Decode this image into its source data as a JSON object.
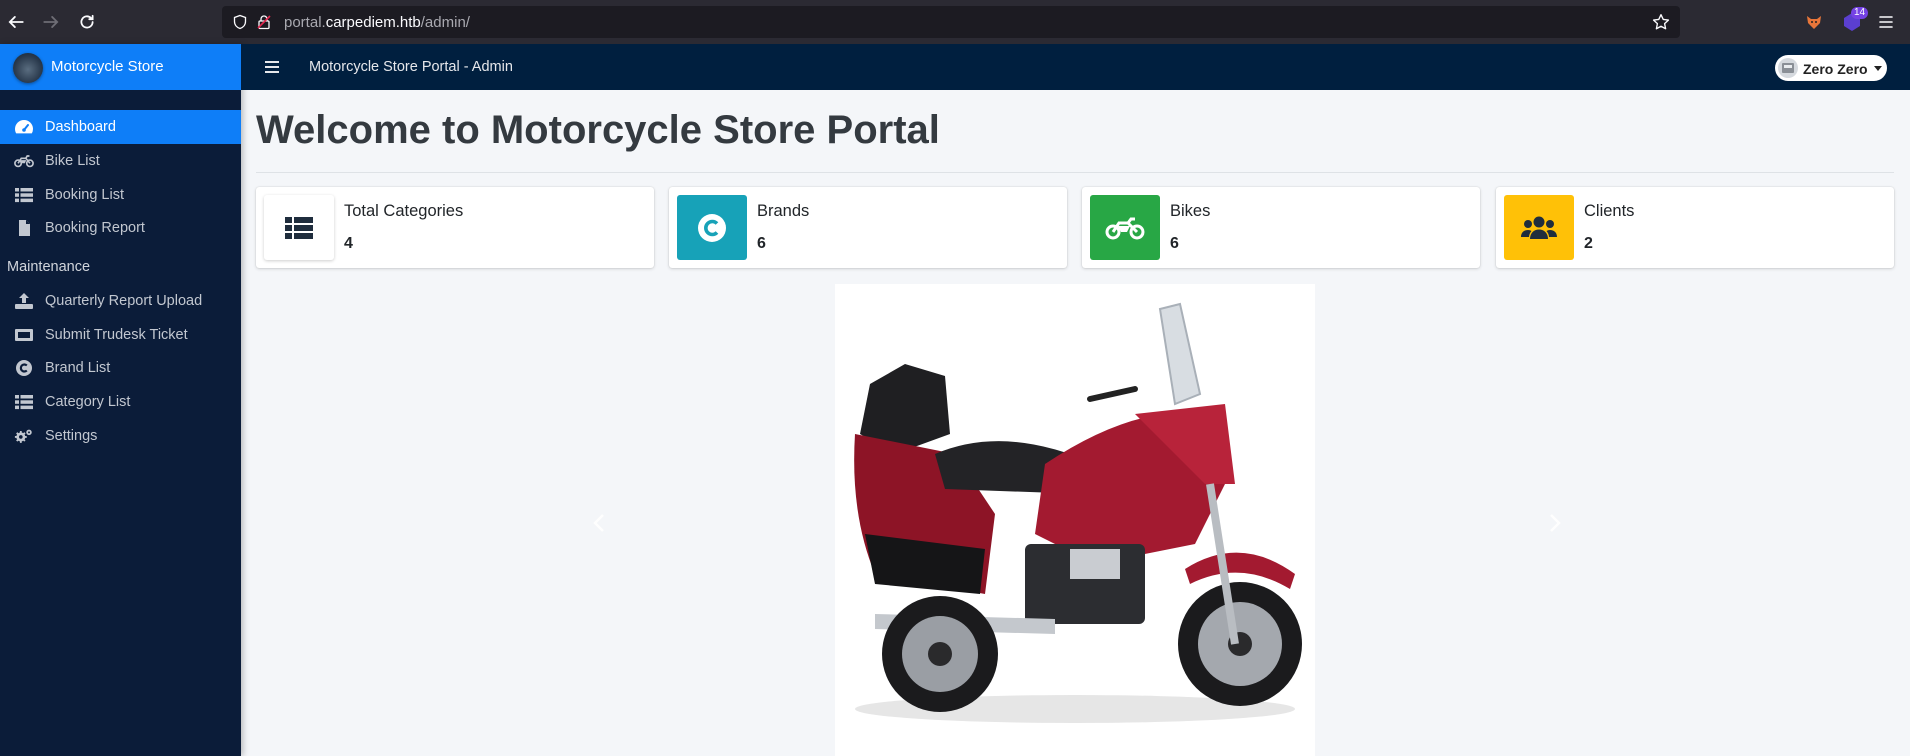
{
  "browser": {
    "url_prefix": "portal.",
    "url_host": "carpediem.htb",
    "url_path": "/admin/",
    "extension_badge": "14"
  },
  "sidebar": {
    "brand": "Motorcycle Store",
    "items": [
      {
        "label": "Dashboard",
        "icon": "tachometer-icon",
        "active": true
      },
      {
        "label": "Bike List",
        "icon": "motorcycle-icon"
      },
      {
        "label": "Booking List",
        "icon": "th-list-icon"
      },
      {
        "label": "Booking Report",
        "icon": "file-icon"
      }
    ],
    "maintenance_header": "Maintenance",
    "maintenance_items": [
      {
        "label": "Quarterly Report Upload",
        "icon": "upload-icon"
      },
      {
        "label": "Submit Trudesk Ticket",
        "icon": "ticket-icon"
      },
      {
        "label": "Brand List",
        "icon": "copyright-icon"
      },
      {
        "label": "Category List",
        "icon": "th-list-icon"
      },
      {
        "label": "Settings",
        "icon": "cogs-icon"
      }
    ]
  },
  "topbar": {
    "title": "Motorcycle Store Portal - Admin",
    "user_name": "Zero Zero"
  },
  "main": {
    "page_title": "Welcome to Motorcycle Store Portal",
    "info_boxes": [
      {
        "label": "Total Categories",
        "value": "4",
        "icon": "th-list-icon",
        "color": "#ffffff"
      },
      {
        "label": "Brands",
        "value": "6",
        "icon": "copyright-icon",
        "color": "#17a2b8"
      },
      {
        "label": "Bikes",
        "value": "6",
        "icon": "motorcycle-icon",
        "color": "#28a745"
      },
      {
        "label": "Clients",
        "value": "2",
        "icon": "users-icon",
        "color": "#ffc107"
      }
    ],
    "carousel": {
      "image": "red-touring-motorcycle"
    }
  },
  "colors": {
    "sidebar_bg": "#0b1c39",
    "accent": "#0e7ef8",
    "topbar_bg": "#001f3f"
  }
}
